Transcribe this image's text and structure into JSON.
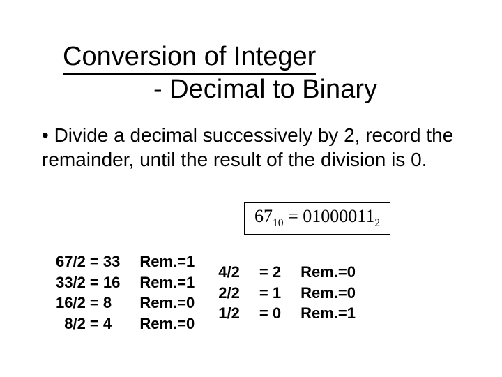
{
  "title": {
    "main": "Conversion of Integer",
    "sub": "- Decimal to Binary"
  },
  "bullet": "• Divide a decimal successively by 2, record the remainder, until the result of the division is 0.",
  "equation": {
    "lhs_base": "67",
    "lhs_sub": "10",
    "eq": " = ",
    "rhs_base": "01000011",
    "rhs_sub": "2"
  },
  "cols": {
    "div1": "67/2 = 33\n33/2 = 16\n16/2 = 8\n  8/2 = 4",
    "rem1": "Rem.=1\nRem.=1\nRem.=0\nRem.=0",
    "div2": "4/2\n2/2\n1/2",
    "res2": "= 2\n= 1\n= 0",
    "rem2": "Rem.=0\nRem.=0\nRem.=1"
  }
}
